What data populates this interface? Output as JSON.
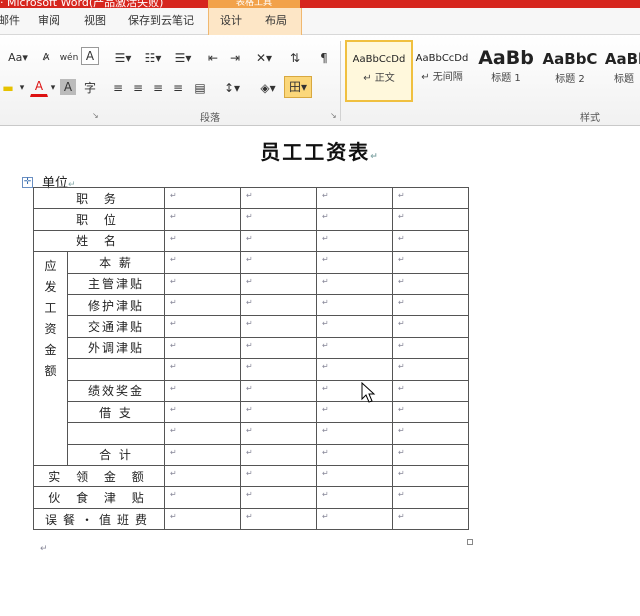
{
  "window": {
    "title": "· Microsoft Word(产品激活失败)",
    "context_tab_group": "表格工具"
  },
  "tabs": [
    {
      "label": "邮件",
      "active": false
    },
    {
      "label": "审阅",
      "active": false
    },
    {
      "label": "视图",
      "active": false
    },
    {
      "label": "保存到云笔记",
      "active": false
    },
    {
      "label": "设计",
      "active": false
    },
    {
      "label": "布局",
      "active": false
    }
  ],
  "ribbon": {
    "font_buttons": {
      "change_case": "Aa▾",
      "phonetic": "wén",
      "char_border": "A",
      "font_color": "A",
      "char_shading": "A",
      "enclosed_char": "字"
    },
    "paragraph_group_label": "段落",
    "styles_group_label": "样式",
    "styles": [
      {
        "sample": "AaBbCcDd",
        "name": "↵ 正文",
        "selected": true
      },
      {
        "sample": "AaBbCcDd",
        "name": "↵ 无间隔",
        "selected": false
      },
      {
        "sample": "AaBb",
        "name": "标题 1",
        "selected": false
      },
      {
        "sample": "AaBbC",
        "name": "标题 2",
        "selected": false
      },
      {
        "sample": "AaBl",
        "name": "标题",
        "selected": false
      }
    ]
  },
  "document": {
    "title": "员工工资表",
    "unit_label": "单位",
    "rows": [
      {
        "label": "职    务"
      },
      {
        "label": "职    位"
      },
      {
        "label": "姓    名"
      },
      {
        "sub": "本    薪"
      },
      {
        "sub": "主管津贴"
      },
      {
        "sub": "修护津贴"
      },
      {
        "sub": "交通津贴"
      },
      {
        "sub": "外调津贴"
      },
      {
        "sub": ""
      },
      {
        "sub": "绩效奖金"
      },
      {
        "sub": "借    支"
      },
      {
        "sub": ""
      },
      {
        "sub": "合    计"
      },
      {
        "label": "实 领 金 额"
      },
      {
        "label": "伙 食 津 贴"
      },
      {
        "label": "误餐・值班费"
      }
    ],
    "category_label": "应发工资金额"
  }
}
